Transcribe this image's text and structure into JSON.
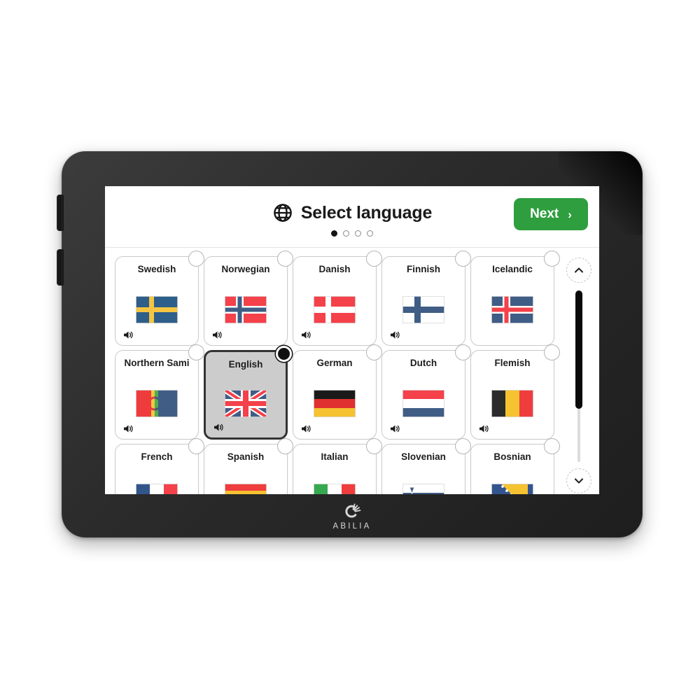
{
  "device": {
    "brand": "ABILIA",
    "brand_mark_icon": "abilia-logo-icon",
    "side_buttons": [
      "power-button",
      "volume-button"
    ]
  },
  "header": {
    "globe_icon": "globe-icon",
    "title": "Select language",
    "next_label": "Next",
    "next_chevron": "›",
    "next_color": "#2f9e3f",
    "pagination": {
      "total": 4,
      "current": 1
    }
  },
  "scroll": {
    "up_icon": "chevron-up-icon",
    "down_icon": "chevron-down-icon",
    "thumb_position_percent": 0,
    "thumb_size_percent": 69
  },
  "grid": {
    "selected": "English",
    "speaker_icon": "speaker-icon",
    "items": [
      {
        "label": "Swedish",
        "flag": "se",
        "has_speaker": true,
        "selected": false
      },
      {
        "label": "Norwegian",
        "flag": "no",
        "has_speaker": true,
        "selected": false
      },
      {
        "label": "Danish",
        "flag": "dk",
        "has_speaker": true,
        "selected": false
      },
      {
        "label": "Finnish",
        "flag": "fi",
        "has_speaker": true,
        "selected": false
      },
      {
        "label": "Icelandic",
        "flag": "is",
        "has_speaker": false,
        "selected": false
      },
      {
        "label": "Northern Sami",
        "flag": "se-sami",
        "has_speaker": true,
        "selected": false
      },
      {
        "label": "English",
        "flag": "gb",
        "has_speaker": true,
        "selected": true
      },
      {
        "label": "German",
        "flag": "de",
        "has_speaker": true,
        "selected": false
      },
      {
        "label": "Dutch",
        "flag": "nl",
        "has_speaker": true,
        "selected": false
      },
      {
        "label": "Flemish",
        "flag": "be",
        "has_speaker": true,
        "selected": false
      },
      {
        "label": "French",
        "flag": "fr",
        "has_speaker": false,
        "selected": false
      },
      {
        "label": "Spanish",
        "flag": "es",
        "has_speaker": false,
        "selected": false
      },
      {
        "label": "Italian",
        "flag": "it",
        "has_speaker": false,
        "selected": false
      },
      {
        "label": "Slovenian",
        "flag": "si",
        "has_speaker": false,
        "selected": false
      },
      {
        "label": "Bosnian",
        "flag": "ba",
        "has_speaker": false,
        "selected": false
      }
    ]
  }
}
